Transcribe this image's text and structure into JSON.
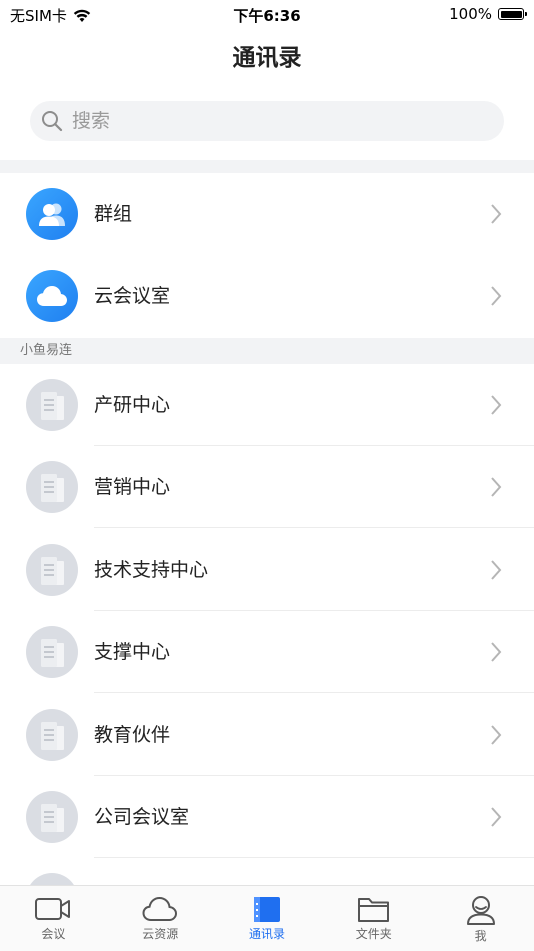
{
  "status": {
    "carrier": "无SIM卡",
    "time": "下午6:36",
    "battery": "100%"
  },
  "nav": {
    "title": "通讯录"
  },
  "search": {
    "placeholder": "搜索"
  },
  "top_items": [
    {
      "label": "群组",
      "icon": "group-icon"
    },
    {
      "label": "云会议室",
      "icon": "cloud-icon"
    }
  ],
  "section": {
    "title": "小鱼易连"
  },
  "departments": [
    {
      "label": "产研中心"
    },
    {
      "label": "营销中心"
    },
    {
      "label": "技术支持中心"
    },
    {
      "label": "支撑中心"
    },
    {
      "label": "教育伙伴"
    },
    {
      "label": "公司会议室"
    }
  ],
  "tabs": [
    {
      "label": "会议",
      "icon": "camera-icon"
    },
    {
      "label": "云资源",
      "icon": "cloud-icon"
    },
    {
      "label": "通讯录",
      "icon": "contacts-book-icon",
      "active": true
    },
    {
      "label": "文件夹",
      "icon": "folder-icon"
    },
    {
      "label": "我",
      "icon": "person-icon"
    }
  ],
  "colors": {
    "accent": "#1f6ff0",
    "icon_blue": "#2a93fa",
    "avatar_gray": "#dadde3"
  }
}
